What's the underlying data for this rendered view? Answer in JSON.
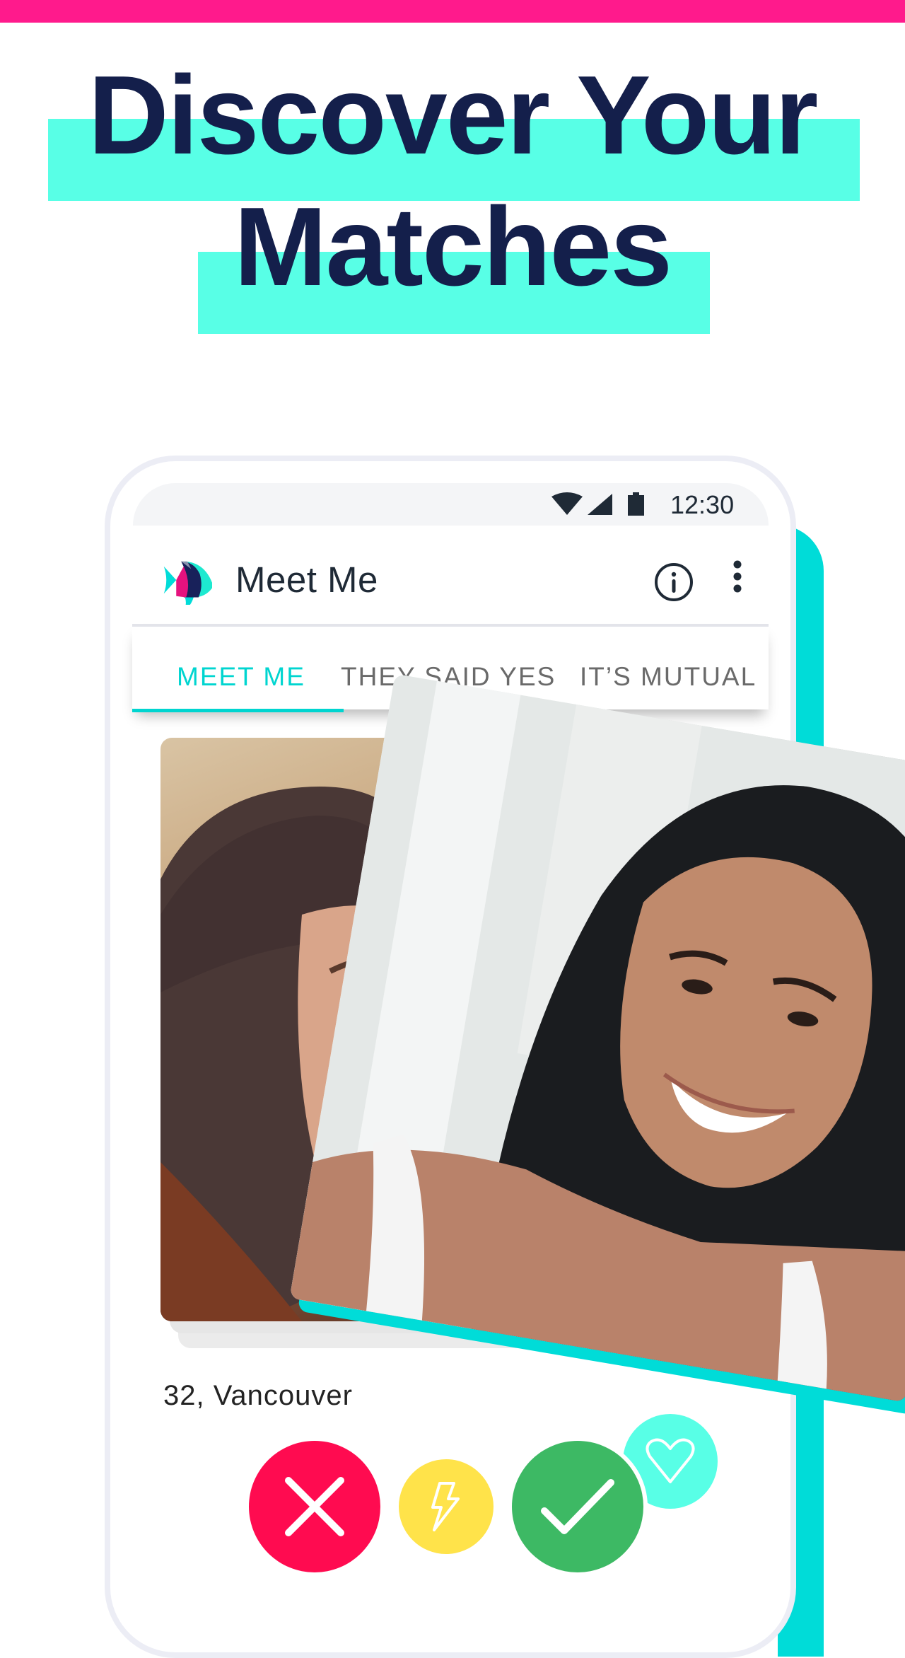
{
  "hero": {
    "line1": "Discover Your",
    "line2": "Matches"
  },
  "colors": {
    "accent_pink": "#ff1a8c",
    "highlight": "#58ffe6",
    "headline_navy": "#141f4b",
    "tab_active": "#00d5d0",
    "teal": "#00dcd8",
    "dislike": "#ff0b50",
    "boost": "#ffe34a",
    "like": "#3db964"
  },
  "status_bar": {
    "time": "12:30",
    "icons": [
      "wifi-icon",
      "signal-icon",
      "battery-icon"
    ]
  },
  "app_bar": {
    "title": "Meet Me",
    "logo": "fish-logo-icon",
    "actions": [
      "info-icon",
      "more-vert-icon"
    ]
  },
  "tabs": [
    {
      "label": "MEET ME",
      "active": true
    },
    {
      "label": "THEY SAID YES",
      "active": false
    },
    {
      "label": "IT’S MUTUAL",
      "active": false
    }
  ],
  "profile": {
    "caption": "32, Vancouver"
  },
  "actions": [
    {
      "name": "dislike",
      "icon": "close-icon"
    },
    {
      "name": "boost",
      "icon": "lightning-icon"
    },
    {
      "name": "like",
      "icon": "check-icon"
    },
    {
      "name": "favorite",
      "icon": "heart-icon"
    }
  ]
}
